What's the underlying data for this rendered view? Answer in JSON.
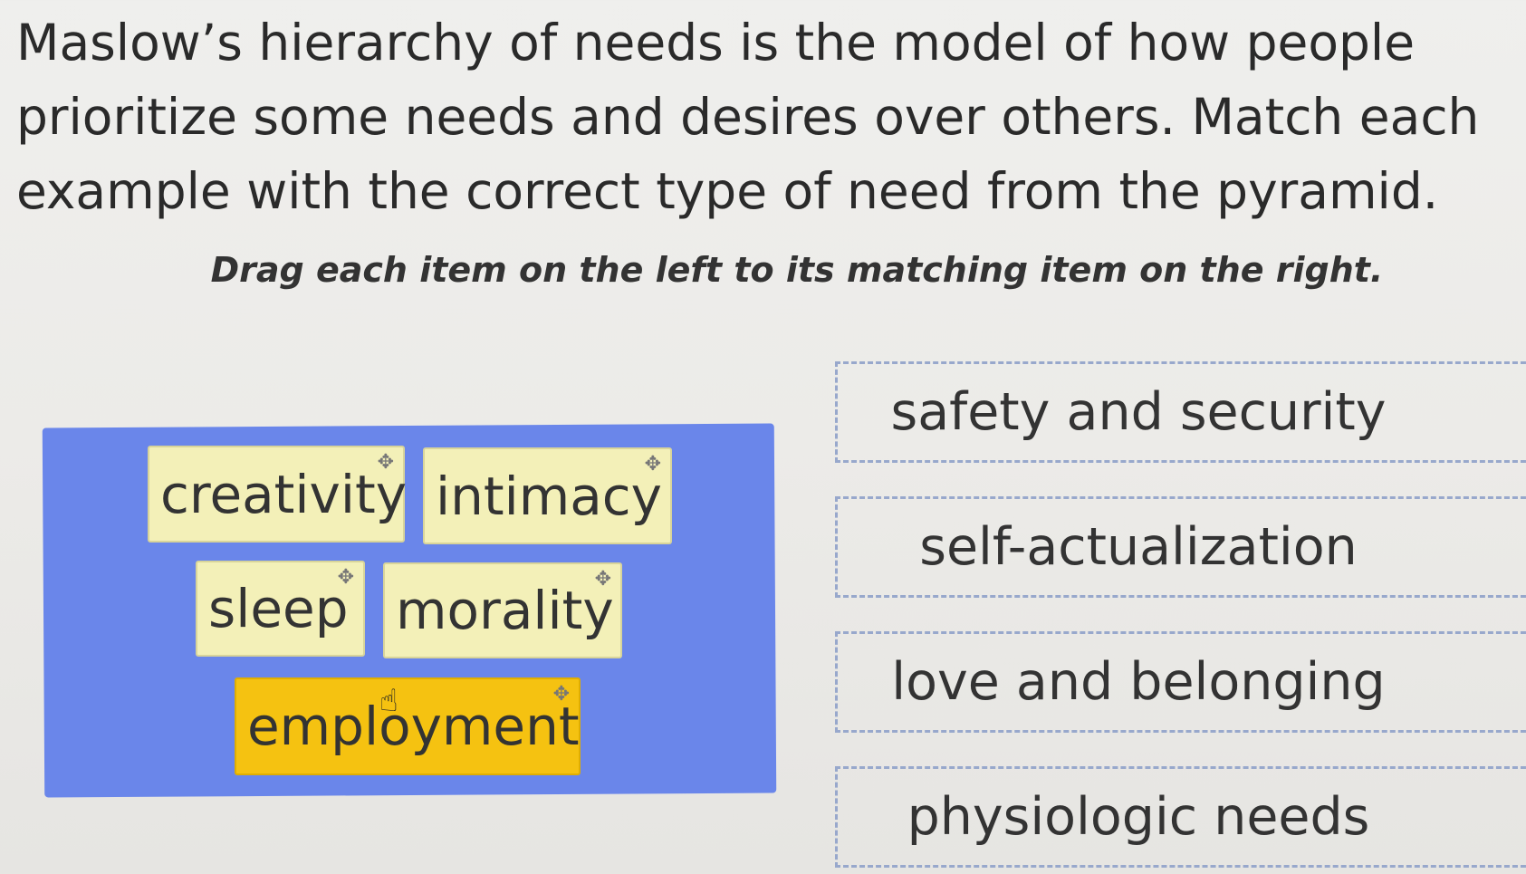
{
  "question": "Maslow’s hierarchy of needs is the model of how people prioritize some needs and desires over others. Match each example with the correct type of need from the pyramid.",
  "instruction": "Drag each item on the left to its matching item on the right.",
  "drag_items": [
    {
      "label": "creativity",
      "selected": false
    },
    {
      "label": "intimacy",
      "selected": false
    },
    {
      "label": "sleep",
      "selected": false
    },
    {
      "label": "morality",
      "selected": false
    },
    {
      "label": "employment",
      "selected": true
    }
  ],
  "drop_targets": [
    {
      "label": "safety and security"
    },
    {
      "label": "self-actualization"
    },
    {
      "label": "love and belonging"
    },
    {
      "label": "physiologic needs"
    }
  ],
  "icons": {
    "move": "move-handle-icon",
    "cursor": "hand-pointer-icon"
  },
  "colors": {
    "panel": "#6a86ea",
    "chip": "#f3f0b8",
    "chip_selected": "#f5c211",
    "target_border": "#98a8cc"
  }
}
